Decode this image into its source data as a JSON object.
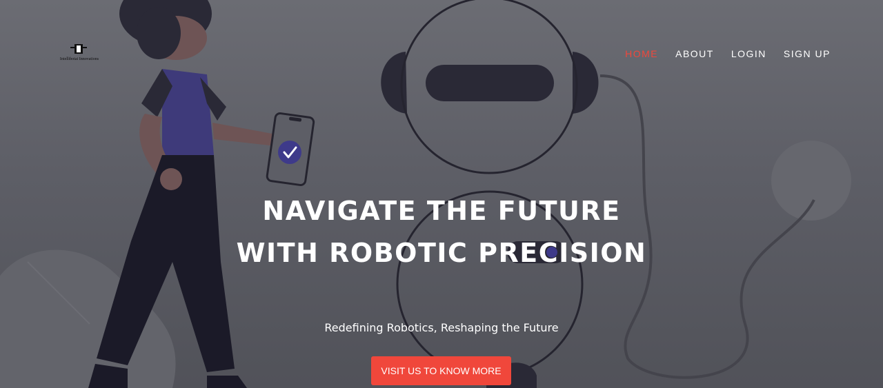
{
  "brand": {
    "name": "Intellibotai Innovations"
  },
  "nav": {
    "items": [
      {
        "label": "HOME",
        "active": true
      },
      {
        "label": "ABOUT",
        "active": false
      },
      {
        "label": "LOGIN",
        "active": false
      },
      {
        "label": "SIGN UP",
        "active": false
      }
    ]
  },
  "hero": {
    "title": "NAVIGATE THE FUTURE WITH ROBOTIC PRECISION",
    "subtitle": "Redefining Robotics, Reshaping the Future",
    "cta_label": "VISIT US TO KNOW MORE"
  },
  "colors": {
    "accent": "#f0473b",
    "overlay": "#5d5e66",
    "text": "#ffffff",
    "phone_check": "#3e3a8a"
  },
  "icons": [
    "check-icon"
  ]
}
